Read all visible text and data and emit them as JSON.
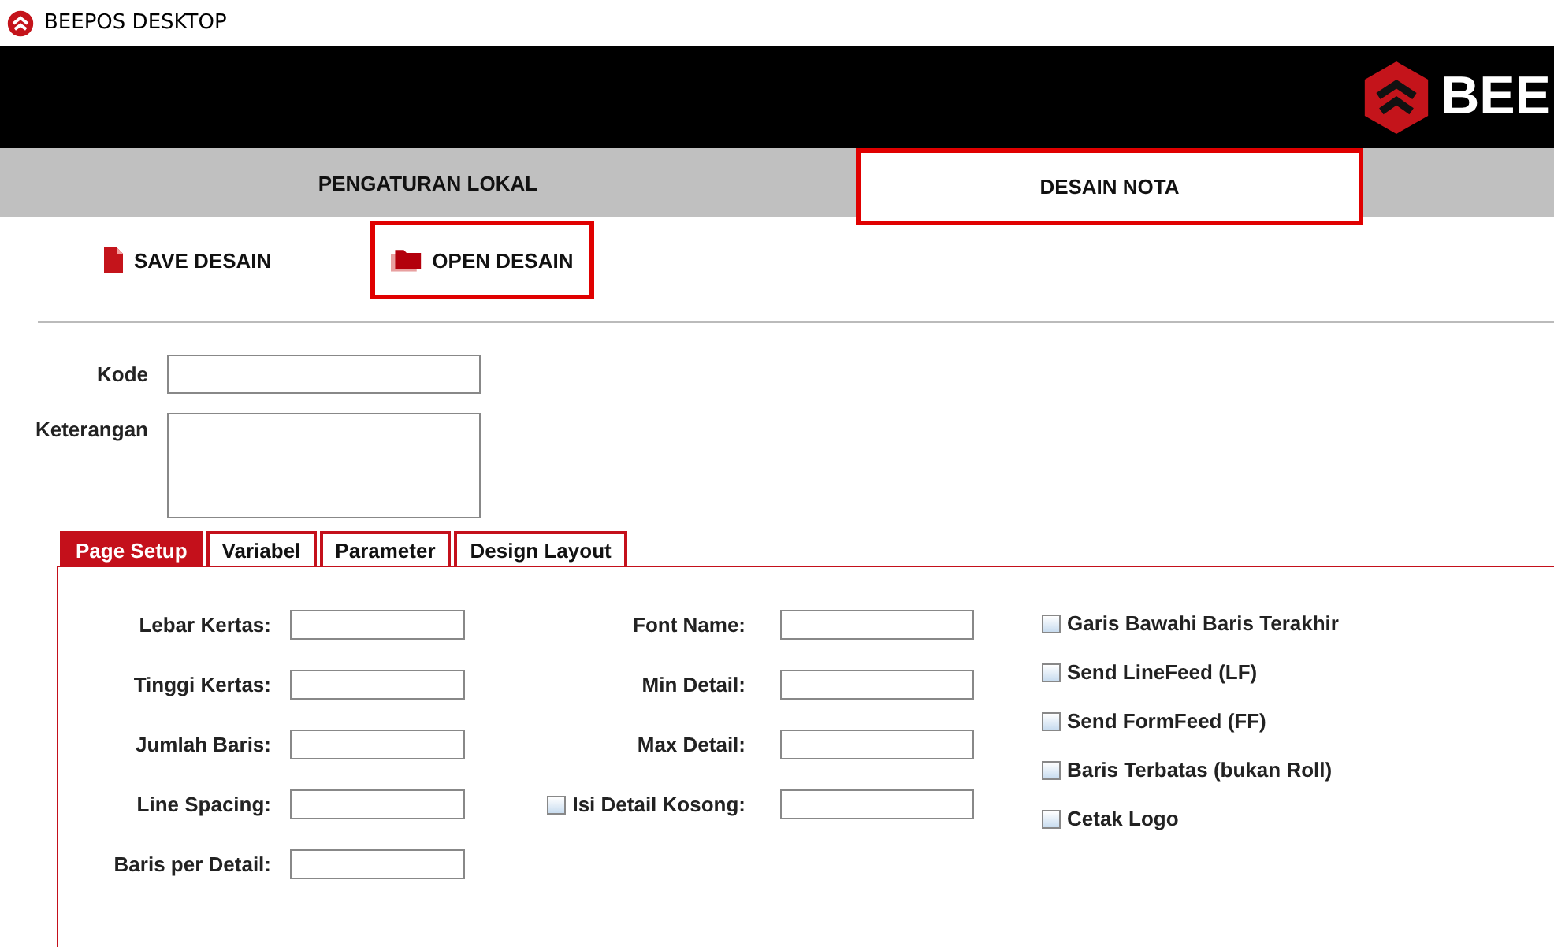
{
  "window": {
    "title": "BEEPOS DESKTOP"
  },
  "header": {
    "logo_text": "BEE"
  },
  "nav_tabs": [
    {
      "label": "PENGATURAN LOKAL",
      "selected": false
    },
    {
      "label": "DESAIN NOTA",
      "selected": true
    }
  ],
  "toolbar": [
    {
      "label": "SAVE DESAIN",
      "kind": "file",
      "highlighted": false
    },
    {
      "label": "OPEN DESAIN",
      "kind": "folder",
      "highlighted": true
    }
  ],
  "form": {
    "kode": {
      "label": "Kode"
    },
    "keterangan": {
      "label": "Keterangan"
    }
  },
  "tabs": [
    {
      "label": "Page Setup",
      "selected": true
    },
    {
      "label": "Variabel",
      "selected": false
    },
    {
      "label": "Parameter",
      "selected": false
    },
    {
      "label": "Design Layout",
      "selected": false
    }
  ],
  "page_setup": {
    "column_1": [
      {
        "label": "Lebar Kertas:"
      },
      {
        "label": "Tinggi Kertas:"
      },
      {
        "label": "Jumlah Baris:"
      },
      {
        "label": "Line Spacing:"
      },
      {
        "label": "Baris per Detail:"
      }
    ],
    "column_2": [
      {
        "label": "Font Name:",
        "kind": "field"
      },
      {
        "label": "Min Detail:",
        "kind": "field"
      },
      {
        "label": "Max Detail:",
        "kind": "field"
      },
      {
        "label": "Isi Detail Kosong:",
        "kind": "checkbox",
        "checked": false
      }
    ],
    "options": [
      {
        "label": "Garis Bawahi Baris Terakhir",
        "checked": false
      },
      {
        "label": "Send LineFeed (LF)",
        "checked": false
      },
      {
        "label": "Send FormFeed (FF)",
        "checked": false
      },
      {
        "label": "Baris Terbatas (bukan Roll)",
        "checked": false
      },
      {
        "label": "Cetak Logo",
        "checked": false
      }
    ]
  }
}
